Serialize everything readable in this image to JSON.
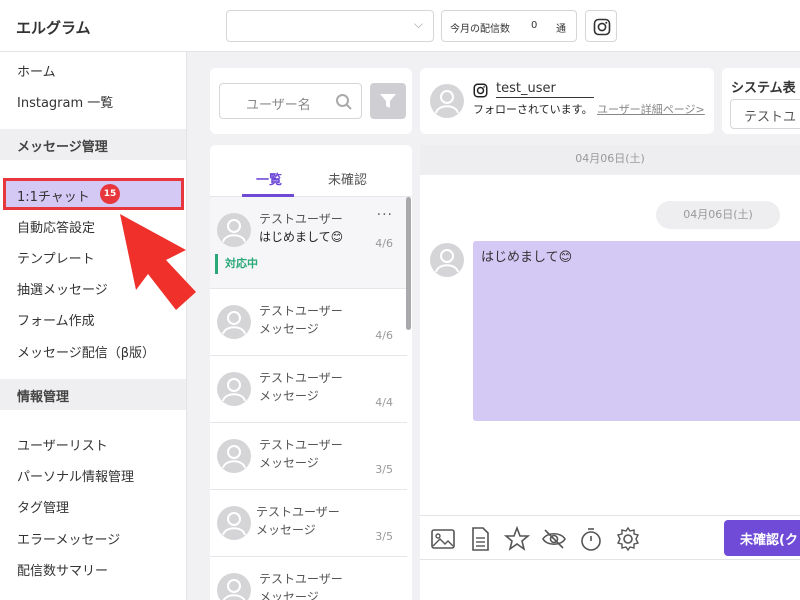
{
  "app": {
    "title": "エルグラム"
  },
  "topbar": {
    "delivery_label": "今月の配信数",
    "delivery_count": "0",
    "delivery_unit": "通"
  },
  "sidebar": {
    "items_top": [
      "ホーム",
      "Instagram 一覧"
    ],
    "section_message": "メッセージ管理",
    "active_item": {
      "label": "1:1チャット",
      "badge": "15"
    },
    "items_message": [
      "自動応答設定",
      "テンプレート",
      "抽選メッセージ",
      "フォーム作成",
      "メッセージ配信（β版）"
    ],
    "section_info": "情報管理",
    "items_info": [
      "ユーザーリスト",
      "パーソナル情報管理",
      "タグ管理",
      "エラーメッセージ",
      "配信数サマリー"
    ]
  },
  "search": {
    "placeholder": "ユーザー名"
  },
  "chat_list": {
    "tabs": [
      "一覧",
      "未確認"
    ],
    "rows": [
      {
        "name": "テストユーザー",
        "message": "はじめまして😊",
        "date": "4/6",
        "status": "対応中",
        "more": "···"
      },
      {
        "name": "テストユーザー",
        "message": "メッセージ",
        "date": "4/6"
      },
      {
        "name": "テストユーザー",
        "message": "メッセージ",
        "date": "4/4"
      },
      {
        "name": "テストユーザー",
        "message": "メッセージ",
        "date": "3/5"
      },
      {
        "name": "テストユーザー",
        "message": "メッセージ",
        "date": "3/5"
      },
      {
        "name": "テストユーザー",
        "message": "メッセージ",
        "date": ""
      }
    ]
  },
  "chat_header": {
    "username": "test_user",
    "follow_status": "フォローされています。",
    "detail_link": "ユーザー詳細ページ>"
  },
  "system_panel": {
    "title": "システム表",
    "select_value": "テストユ"
  },
  "chat": {
    "date_header": "04月06日(土)",
    "date_chip": "04月06日(土)",
    "message": "はじめまして😊"
  },
  "toolbar": {
    "unread_button": "未確認(ク"
  },
  "colors": {
    "accent": "#6f4bd8",
    "highlight": "#d4c8f5",
    "badge": "#e8373c",
    "status": "#2ba877"
  }
}
